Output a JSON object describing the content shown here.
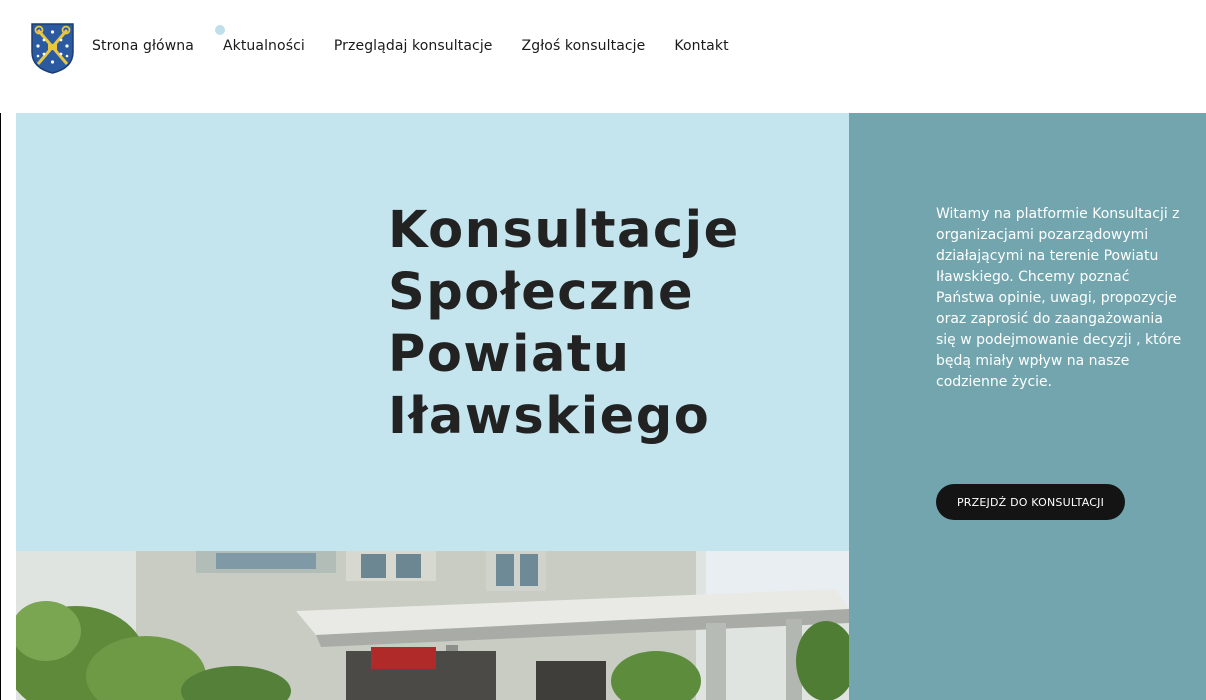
{
  "header": {
    "logo_alt": "Herb Powiatu Iławskiego",
    "nav": [
      {
        "label": "Strona główna"
      },
      {
        "label": "Aktualności"
      },
      {
        "label": "Przeglądaj konsultacje"
      },
      {
        "label": "Zgłoś konsultacje"
      },
      {
        "label": "Kontakt"
      }
    ]
  },
  "hero": {
    "title_lines": [
      "Konsultacje",
      "Społeczne",
      "Powiatu",
      "Iławskiego"
    ],
    "intro": "Witamy na platformie Konsultacji z organizacjami pozarządowymi działającymi na terenie Powiatu Iławskiego. Chcemy poznać Państwa opinie, uwagi, propozycje oraz zaprosić do zaangażowania się w podejmowanie decyzji , które będą miały wpływ na nasze codzienne życie.",
    "cta_label": "PRZEJDŹ DO KONSULTACJI"
  },
  "colors": {
    "hero_light": "#c4e4ee",
    "hero_side": "#72a5ae",
    "cta_bg": "#141414",
    "nav_dot": "#bfe0ea"
  },
  "icons": {
    "logo": "county-crest-icon"
  }
}
